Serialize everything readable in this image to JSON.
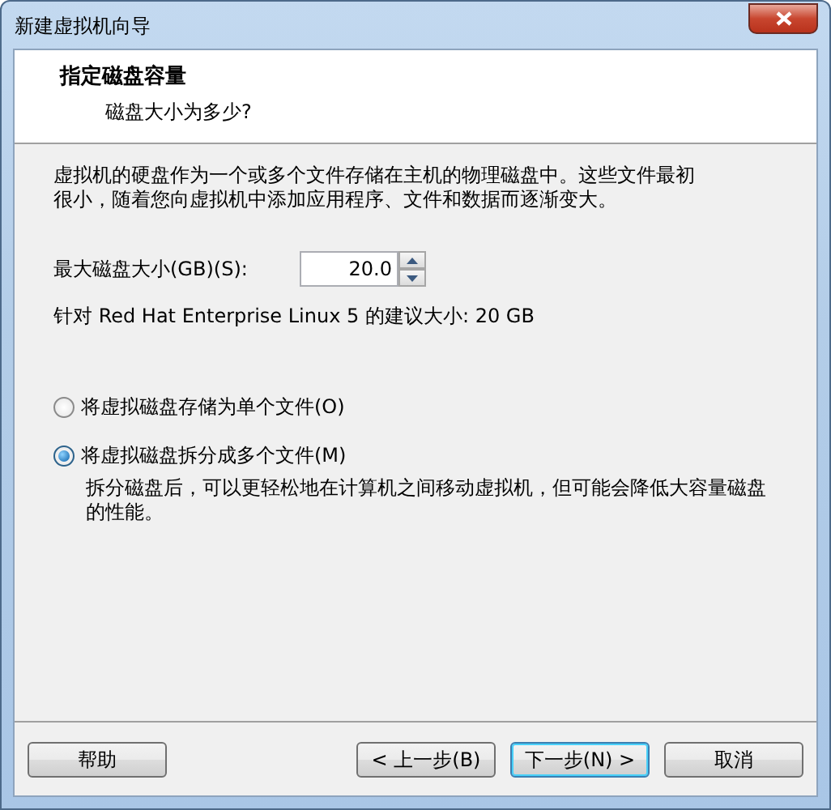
{
  "window": {
    "title": "新建虚拟机向导"
  },
  "header": {
    "title": "指定磁盘容量",
    "subtitle": "磁盘大小为多少?"
  },
  "description": "虚拟机的硬盘作为一个或多个文件存储在主机的物理磁盘中。这些文件最初很小，随着您向虚拟机中添加应用程序、文件和数据而逐渐变大。",
  "size_field": {
    "label": "最大磁盘大小(GB)(S):",
    "value": "20.0"
  },
  "recommendation": "针对 Red Hat Enterprise Linux 5 的建议大小: 20 GB",
  "options": [
    {
      "label": "将虚拟磁盘存储为单个文件(O)",
      "selected": false
    },
    {
      "label": "将虚拟磁盘拆分成多个文件(M)",
      "selected": true,
      "description": "拆分磁盘后，可以更轻松地在计算机之间移动虚拟机，但可能会降低大容量磁盘的性能。"
    }
  ],
  "buttons": [
    {
      "label": "帮助",
      "kind": "left",
      "default": false
    },
    {
      "label": "< 上一步(B)",
      "kind": "right",
      "default": false
    },
    {
      "label": "下一步(N) >",
      "kind": "right",
      "default": true
    },
    {
      "label": "取消",
      "kind": "right",
      "default": false
    }
  ]
}
